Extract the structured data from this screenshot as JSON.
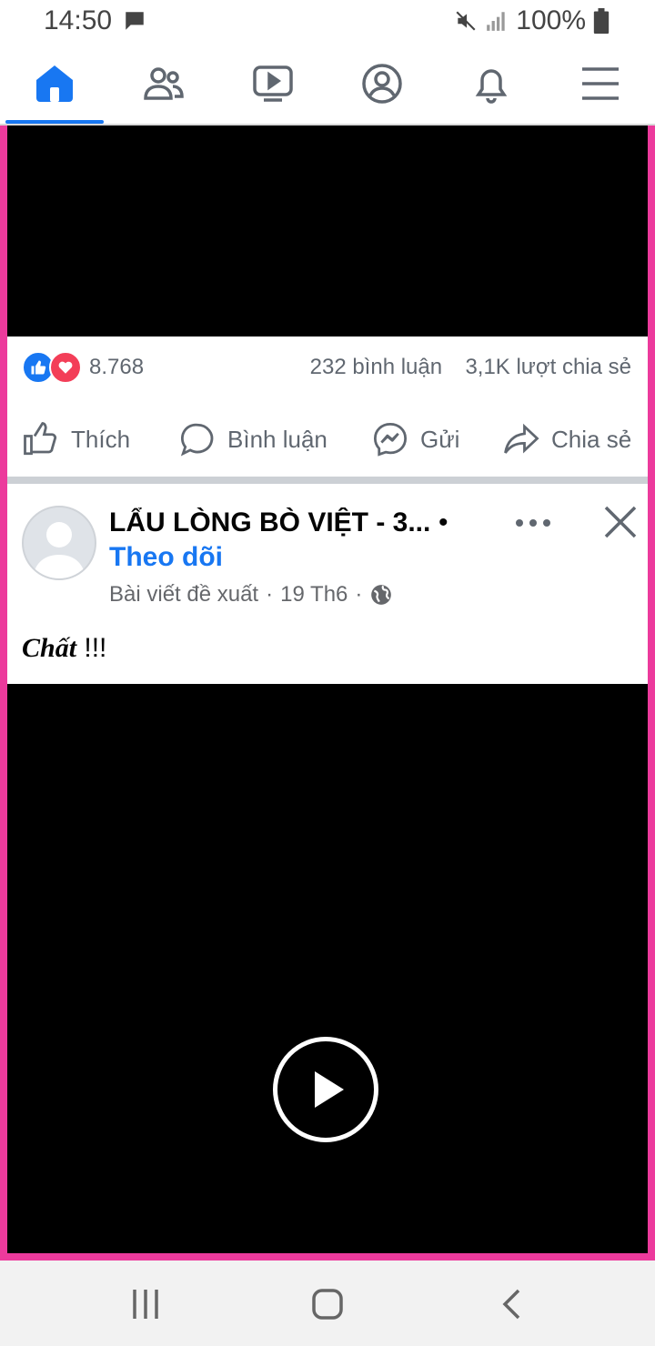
{
  "status_bar": {
    "time": "14:50",
    "battery": "100%",
    "icons": [
      "message-icon",
      "mute-icon",
      "signal-icon",
      "battery-icon"
    ]
  },
  "nav": {
    "tabs": [
      {
        "name": "home",
        "icon": "home-icon",
        "active": true
      },
      {
        "name": "friends",
        "icon": "friends-icon",
        "active": false
      },
      {
        "name": "watch",
        "icon": "video-icon",
        "active": false
      },
      {
        "name": "profile",
        "icon": "profile-icon",
        "active": false
      },
      {
        "name": "notifications",
        "icon": "bell-icon",
        "active": false
      },
      {
        "name": "menu",
        "icon": "menu-icon",
        "active": false
      }
    ],
    "accent_color": "#1877f2"
  },
  "post1": {
    "reaction_count": "8.768",
    "comments": "232 bình luận",
    "shares": "3,1K lượt chia sẻ",
    "actions": {
      "like": "Thích",
      "comment": "Bình luận",
      "send": "Gửi",
      "share": "Chia sẻ"
    }
  },
  "post2": {
    "page_name": "LẨU LÒNG BÒ VIỆT - 3...",
    "separator": "•",
    "follow": "Theo dõi",
    "meta": {
      "type": "Bài viết đề xuất",
      "dot1": "·",
      "date": "19 Th6",
      "dot2": "·"
    },
    "caption_styled": "Chất",
    "caption_rest": " !!!"
  },
  "colors": {
    "frame_border": "#ec3a9c",
    "link": "#1877f2"
  }
}
